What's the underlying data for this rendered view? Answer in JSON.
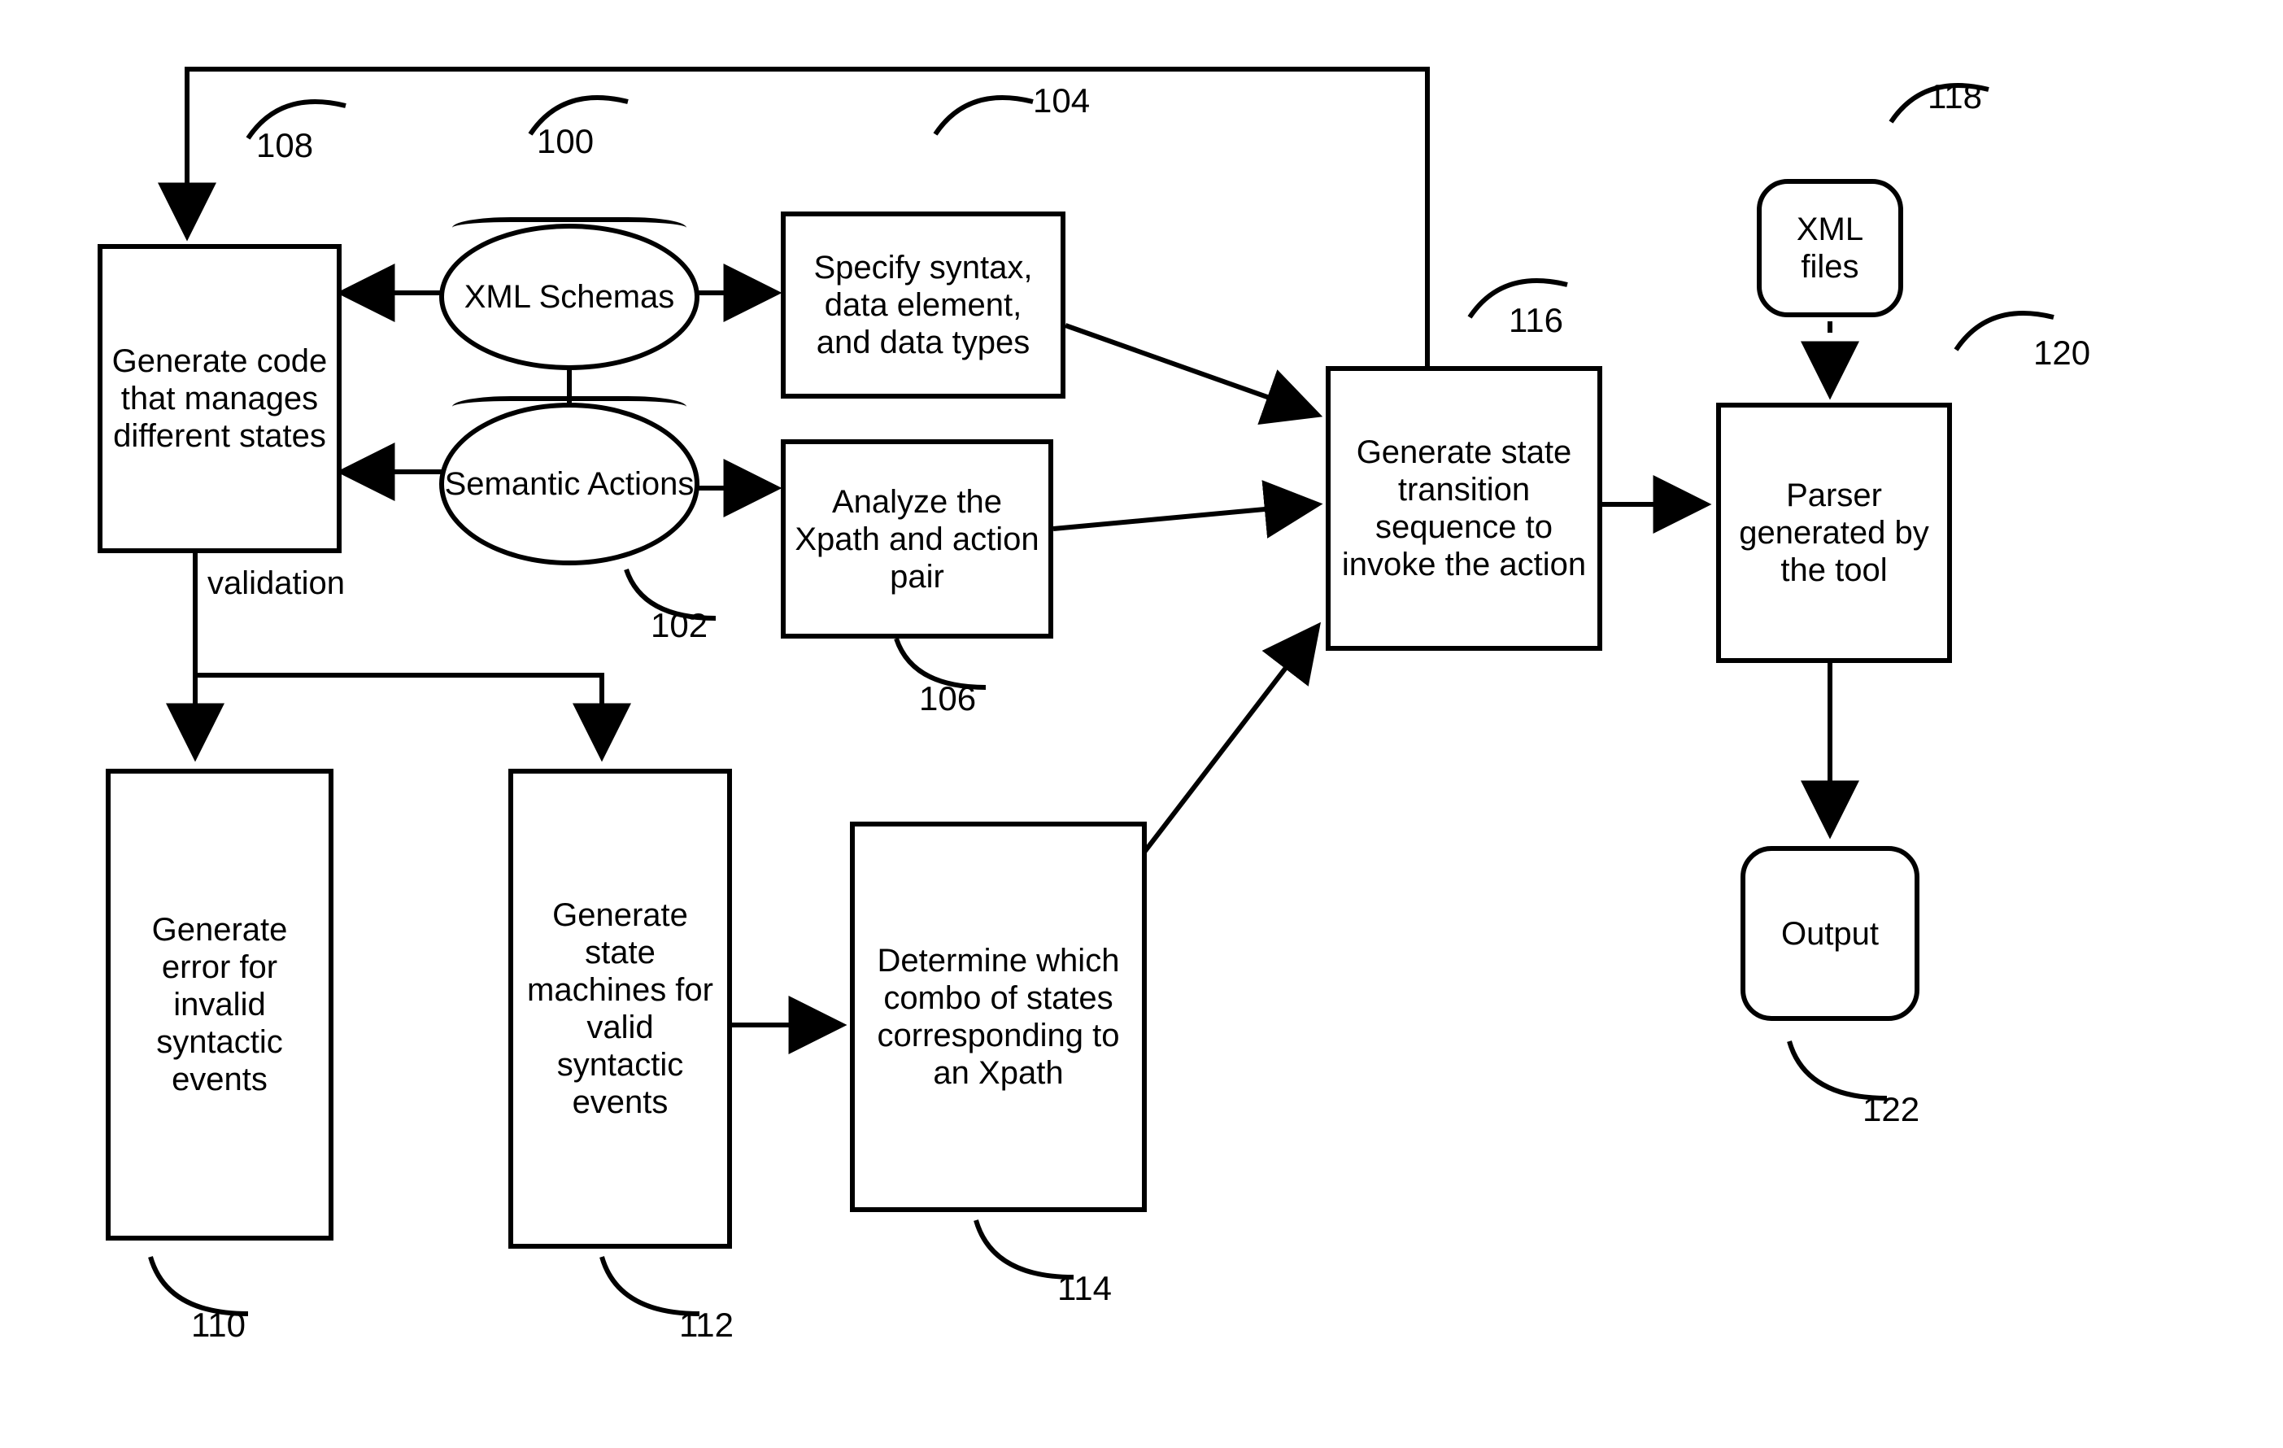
{
  "nodes": {
    "n100": {
      "id": "100",
      "text": "XML Schemas"
    },
    "n102": {
      "id": "102",
      "text": "Semantic Actions"
    },
    "n104": {
      "id": "104",
      "text": "Specify syntax, data element, and data types"
    },
    "n106": {
      "id": "106",
      "text": "Analyze the Xpath and action pair"
    },
    "n108": {
      "id": "108",
      "text": "Generate code that manages different states"
    },
    "n110": {
      "id": "110",
      "text": "Generate error for invalid syntactic events"
    },
    "n112": {
      "id": "112",
      "text": "Generate state machines for valid syntactic events"
    },
    "n114": {
      "id": "114",
      "text": "Determine which combo of states corresponding to an Xpath"
    },
    "n116": {
      "id": "116",
      "text": "Generate state transition sequence to invoke the action"
    },
    "n118": {
      "id": "118",
      "text": "XML files"
    },
    "n120": {
      "id": "120",
      "text": "Parser generated by the tool"
    },
    "n122": {
      "id": "122",
      "text": "Output"
    }
  },
  "edge_labels": {
    "validation": "validation"
  },
  "labels": {
    "l100": "100",
    "l102": "102",
    "l104": "104",
    "l106": "106",
    "l108": "108",
    "l110": "110",
    "l112": "112",
    "l114": "114",
    "l116": "116",
    "l118": "118",
    "l120": "120",
    "l122": "122"
  }
}
